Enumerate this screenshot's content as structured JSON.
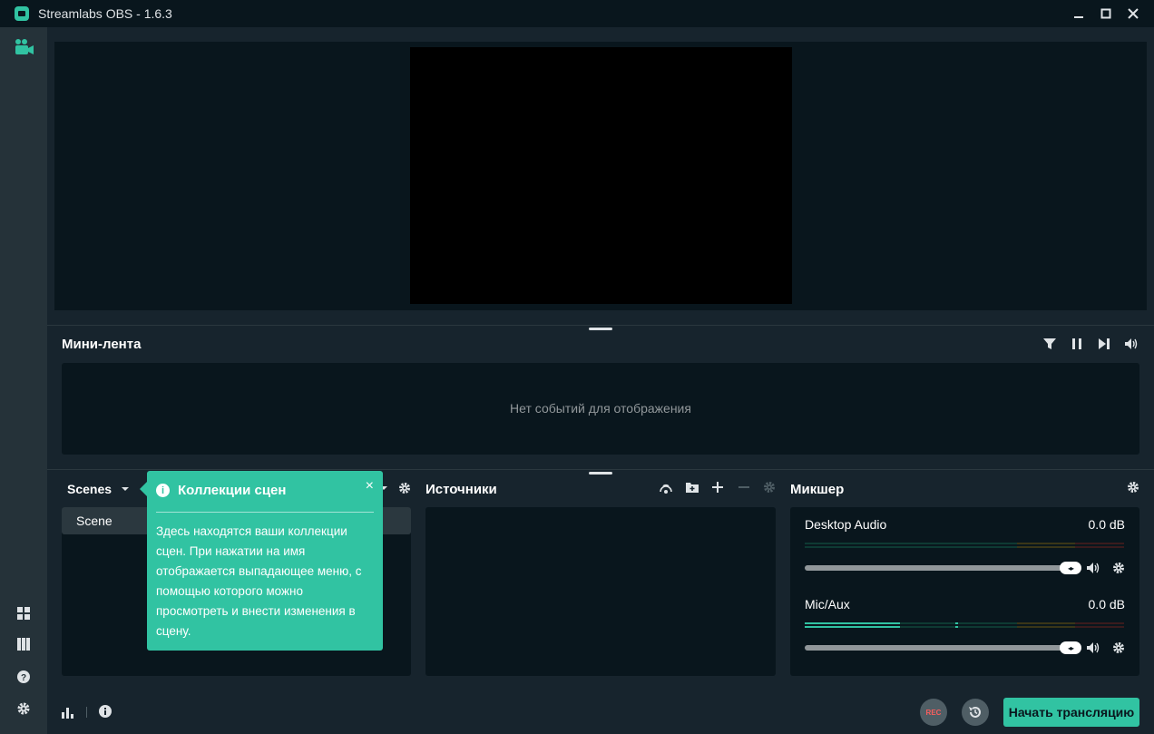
{
  "window": {
    "title": "Streamlabs OBS - 1.6.3",
    "minimize_icon": "minimize-icon",
    "maximize_icon": "maximize-icon",
    "close_icon": "close-icon"
  },
  "colors": {
    "accent": "#31c3a2",
    "background": "#17242d",
    "panel": "#09161d",
    "rec": "#f85e5e"
  },
  "leftnav": {
    "top_items": [
      {
        "icon": "studio-camera-icon",
        "active": true
      }
    ],
    "bottom_items": [
      {
        "icon": "layout-editor-icon"
      },
      {
        "icon": "studio-mode-icon"
      },
      {
        "icon": "help-icon"
      },
      {
        "icon": "settings-icon"
      }
    ]
  },
  "minifeed": {
    "title": "Мини-лента",
    "empty_text": "Нет событий для отображения",
    "tools": [
      "filter-icon",
      "pause-icon",
      "skip-icon",
      "volume-icon"
    ]
  },
  "scenes": {
    "collection_label": "Scenes",
    "items": [
      {
        "name": "Scene",
        "selected": true
      }
    ]
  },
  "sources": {
    "title": "Источники",
    "tools": [
      "scene-selector-icon",
      "add-folder-icon",
      "add-icon",
      "remove-icon",
      "gear-icon"
    ]
  },
  "mixer": {
    "title": "Микшер",
    "channels": [
      {
        "name": "Desktop Audio",
        "db": "0.0 dB",
        "level": 0,
        "volume": 1.0
      },
      {
        "name": "Mic/Aux",
        "db": "0.0 dB",
        "level": 0.3,
        "volume": 1.0
      }
    ]
  },
  "tooltip": {
    "title": "Коллекции сцен",
    "body": "Здесь находятся ваши коллекции сцен. При нажатии на имя отображается выпадающее меню, с помощью которого можно просмотреть и внести изменения в сцену.",
    "close": "×"
  },
  "footer": {
    "rec_label": "REC",
    "go_live_label": "Начать трансляцию"
  }
}
